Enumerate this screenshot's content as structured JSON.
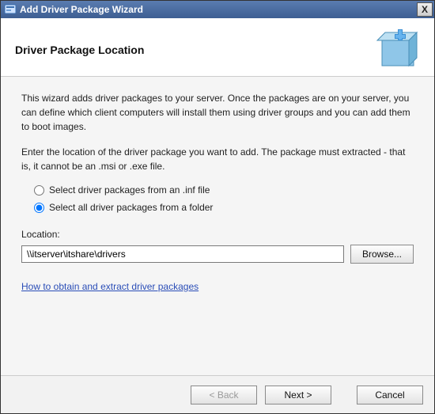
{
  "titlebar": {
    "title": "Add Driver Package Wizard",
    "close_label": "X"
  },
  "header": {
    "title": "Driver Package Location"
  },
  "body": {
    "intro": "This wizard adds driver packages to your server. Once the packages are on your server, you can define which client computers will install them using driver groups and you can add them to boot images.",
    "instruction": "Enter the location of the driver package you want to add. The package must extracted - that is, it cannot be an .msi or .exe file.",
    "radio_inf": "Select driver packages from an .inf file",
    "radio_folder": "Select all driver packages from a folder",
    "location_label": "Location:",
    "location_value": "\\\\itserver\\itshare\\drivers",
    "browse_label": "Browse...",
    "help_link": "How to obtain and extract driver packages"
  },
  "footer": {
    "back": "< Back",
    "next": "Next >",
    "cancel": "Cancel"
  }
}
